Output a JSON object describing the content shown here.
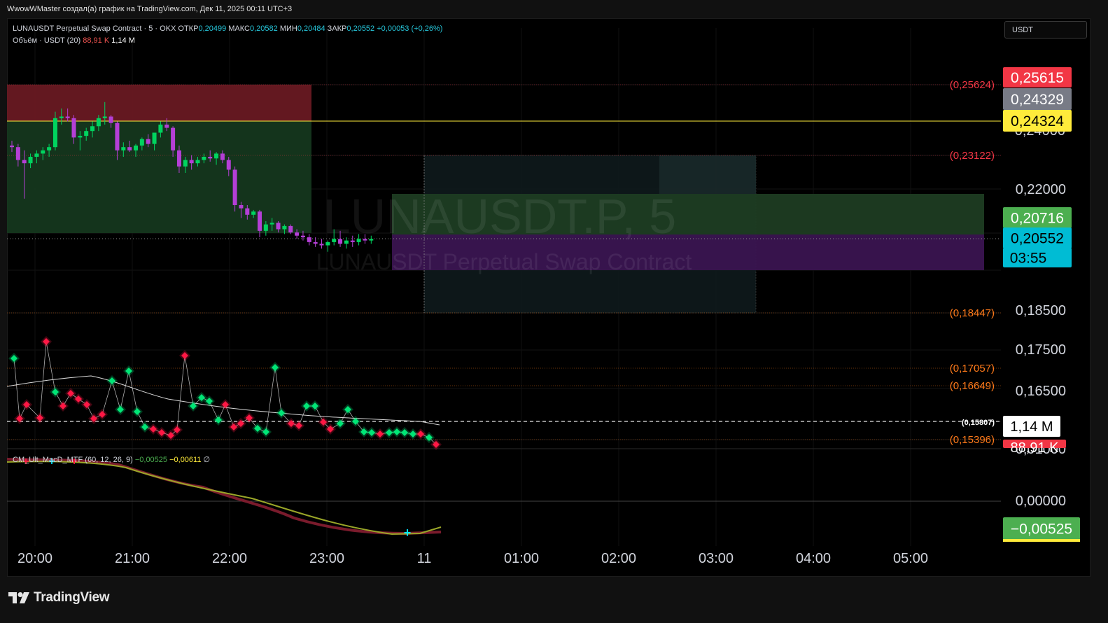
{
  "header": "WwowWMaster создал(а) график на TradingView.com, Дек 11, 2025 00:11 UTC+3",
  "footer": {
    "brand": "TradingView"
  },
  "symbol_legend": {
    "name": "LUNAUSDT Perpetual Swap Contract · 5 · OKX",
    "open_label": "ОТКР",
    "open": "0,20499",
    "high_label": "МАКС",
    "high": "0,20582",
    "low_label": "МИН",
    "low": "0,20484",
    "close_label": "ЗАКР",
    "close": "0,20552",
    "change": "+0,00053 (+0,26%)"
  },
  "volume_legend": {
    "label": "Объём · USDT (20)",
    "value1": "88,91 K",
    "value2": "1,14 M"
  },
  "indicator_legend": {
    "label": "CM_Ult_MacD_MTF (60, 12, 26, 9)",
    "v1": "−0,00525",
    "v2": "−0,00611",
    "v3": "∅"
  },
  "currency": "USDT",
  "watermark": {
    "title": "LUNAUSDT.P, 5",
    "subtitle": "LUNAUSDT Perpetual Swap Contract"
  },
  "colors": {
    "up": "#00d45f",
    "down": "#b43fd6",
    "accent_red": "#f23645",
    "accent_yellow": "#ffeb3b",
    "accent_green": "#4caf50",
    "accent_cyan": "#00bcd4"
  },
  "chart_data": {
    "type": "candlestick",
    "x_labels": [
      "20:00",
      "21:00",
      "22:00",
      "23:00",
      "11",
      "01:00",
      "02:00",
      "03:00",
      "04:00",
      "05:00"
    ],
    "price_ticks": [
      "0,22000",
      "0,18500",
      "0,17500",
      "0,16500",
      "0,01000"
    ],
    "macd_ticks": [
      "0,00000"
    ],
    "candles": [
      [
        0.2335,
        0.235,
        0.2315,
        0.233
      ],
      [
        0.233,
        0.234,
        0.227,
        0.229
      ],
      [
        0.229,
        0.232,
        0.217,
        0.228
      ],
      [
        0.228,
        0.231,
        0.2265,
        0.23
      ],
      [
        0.23,
        0.232,
        0.228,
        0.231
      ],
      [
        0.231,
        0.233,
        0.229,
        0.232
      ],
      [
        0.232,
        0.234,
        0.23,
        0.233
      ],
      [
        0.233,
        0.244,
        0.232,
        0.242
      ],
      [
        0.242,
        0.245,
        0.24,
        0.2425
      ],
      [
        0.2425,
        0.245,
        0.241,
        0.242
      ],
      [
        0.242,
        0.243,
        0.234,
        0.236
      ],
      [
        0.236,
        0.238,
        0.232,
        0.2365
      ],
      [
        0.2365,
        0.239,
        0.235,
        0.238
      ],
      [
        0.238,
        0.241,
        0.236,
        0.2395
      ],
      [
        0.2395,
        0.243,
        0.238,
        0.242
      ],
      [
        0.242,
        0.247,
        0.24,
        0.2425
      ],
      [
        0.2425,
        0.243,
        0.239,
        0.2405
      ],
      [
        0.2405,
        0.241,
        0.229,
        0.232
      ],
      [
        0.232,
        0.2345,
        0.23,
        0.233
      ],
      [
        0.233,
        0.235,
        0.2315,
        0.232
      ],
      [
        0.232,
        0.234,
        0.23,
        0.2335
      ],
      [
        0.2335,
        0.236,
        0.232,
        0.2355
      ],
      [
        0.2355,
        0.237,
        0.233,
        0.234
      ],
      [
        0.234,
        0.2365,
        0.232,
        0.2375
      ],
      [
        0.2375,
        0.241,
        0.236,
        0.24
      ],
      [
        0.24,
        0.242,
        0.238,
        0.239
      ],
      [
        0.239,
        0.2395,
        0.23,
        0.232
      ],
      [
        0.232,
        0.2335,
        0.225,
        0.227
      ],
      [
        0.227,
        0.23,
        0.225,
        0.229
      ],
      [
        0.229,
        0.2305,
        0.226,
        0.228
      ],
      [
        0.228,
        0.23,
        0.227,
        0.229
      ],
      [
        0.229,
        0.231,
        0.228,
        0.23
      ],
      [
        0.23,
        0.232,
        0.2285,
        0.2295
      ],
      [
        0.2295,
        0.2315,
        0.2275,
        0.231
      ],
      [
        0.231,
        0.232,
        0.228,
        0.229
      ],
      [
        0.229,
        0.23,
        0.224,
        0.226
      ],
      [
        0.226,
        0.227,
        0.213,
        0.215
      ],
      [
        0.215,
        0.216,
        0.211,
        0.214
      ],
      [
        0.214,
        0.215,
        0.2105,
        0.212
      ],
      [
        0.212,
        0.2135,
        0.211,
        0.213
      ],
      [
        0.213,
        0.2135,
        0.205,
        0.207
      ],
      [
        0.207,
        0.21,
        0.2055,
        0.209
      ],
      [
        0.209,
        0.211,
        0.207,
        0.2095
      ],
      [
        0.2095,
        0.21,
        0.2065,
        0.2075
      ],
      [
        0.2075,
        0.209,
        0.206,
        0.2085
      ],
      [
        0.2085,
        0.209,
        0.206,
        0.2065
      ],
      [
        0.2065,
        0.2075,
        0.2045,
        0.2055
      ],
      [
        0.2055,
        0.207,
        0.204,
        0.205
      ],
      [
        0.205,
        0.206,
        0.2025,
        0.2035
      ],
      [
        0.2035,
        0.205,
        0.202,
        0.203
      ],
      [
        0.203,
        0.2045,
        0.2015,
        0.2025
      ],
      [
        0.2025,
        0.204,
        0.2005,
        0.2035
      ],
      [
        0.2035,
        0.2075,
        0.2025,
        0.2045
      ],
      [
        0.2045,
        0.207,
        0.202,
        0.203
      ],
      [
        0.203,
        0.205,
        0.2015,
        0.204
      ],
      [
        0.204,
        0.2055,
        0.202,
        0.2035
      ],
      [
        0.2035,
        0.206,
        0.2025,
        0.2045
      ],
      [
        0.2045,
        0.206,
        0.203,
        0.204
      ],
      [
        0.204,
        0.2055,
        0.203,
        0.2045
      ]
    ],
    "levels": [
      {
        "label": "(0,25624)",
        "value": 0.25624,
        "color": "#f23645"
      },
      {
        "label": "(0,23122)",
        "value": 0.23122,
        "color": "#f23645"
      },
      {
        "label": "(0,18447)",
        "value": 0.18447,
        "color": "#ff7a1a"
      },
      {
        "label": "(0,17057)",
        "value": 0.17057,
        "color": "#ff7a1a"
      },
      {
        "label": "(0,16649)",
        "value": 0.16649,
        "color": "#ff7a1a"
      },
      {
        "label": "(0,15807)",
        "value": 0.15807,
        "color": "#ffffff"
      },
      {
        "label": "(0,15396)",
        "value": 0.15396,
        "color": "#ff7a1a"
      }
    ],
    "price_badges": [
      {
        "text": "0,25615",
        "color": "#f23645",
        "text_color": "#ffffff"
      },
      {
        "text": "0,24329",
        "color": "#787b86",
        "text_color": "#ffffff"
      },
      {
        "text": "0,24324",
        "color": "#ffeb3b",
        "text_color": "#000000"
      },
      {
        "text": "0,20716",
        "color": "#4caf50",
        "text_color": "#ffffff"
      },
      {
        "text": "0,20552",
        "color": "#00bcd4",
        "text_color": "#000000"
      },
      {
        "text": "03:55",
        "color": "#00bcd4",
        "text_color": "#000000"
      },
      {
        "text": "1,14 M",
        "color": "#ffffff",
        "text_color": "#000000"
      },
      {
        "text": "88,91 K",
        "color": "#f23645",
        "text_color": "#ffffff"
      },
      {
        "text": "−0,00525",
        "color": "#4caf50",
        "text_color": "#ffffff"
      }
    ]
  }
}
